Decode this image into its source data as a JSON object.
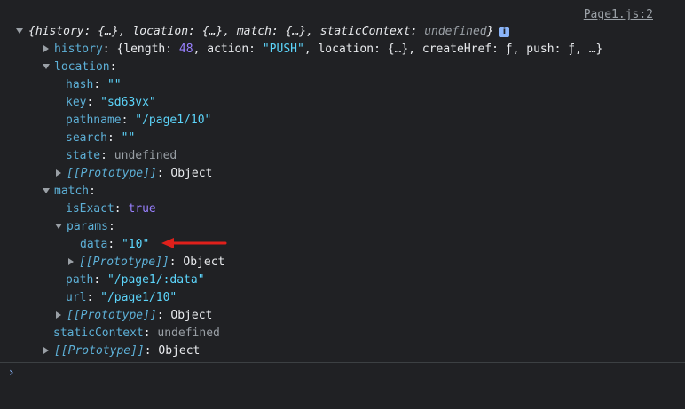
{
  "console": {
    "source_link": "Page1.js:2",
    "summary": {
      "open_brace": "{",
      "k1": "history",
      "v1": "{…}",
      "k2": "location",
      "v2": "{…}",
      "k3": "match",
      "v3": "{…}",
      "k4": "staticContext",
      "v4": "undefined",
      "close_brace": "}",
      "info": "i"
    },
    "history": {
      "key": "history",
      "preview_open": "{length: ",
      "length": "48",
      "sep1": ", action: ",
      "action": "\"PUSH\"",
      "rest": ", location: {…}, createHref: ƒ, push: ƒ, …}"
    },
    "location": {
      "key": "location",
      "hash_key": "hash",
      "hash": "\"\"",
      "key_key": "key",
      "key_val": "\"sd63vx\"",
      "pathname_key": "pathname",
      "pathname": "\"/page1/10\"",
      "search_key": "search",
      "search": "\"\"",
      "state_key": "state",
      "state": "undefined",
      "proto": "[[Prototype]]",
      "proto_val": "Object"
    },
    "match": {
      "key": "match",
      "isExact_key": "isExact",
      "isExact": "true",
      "params_key": "params",
      "data_key": "data",
      "data": "\"10\"",
      "params_proto": "[[Prototype]]",
      "params_proto_val": "Object",
      "path_key": "path",
      "path": "\"/page1/:data\"",
      "url_key": "url",
      "url": "\"/page1/10\"",
      "proto": "[[Prototype]]",
      "proto_val": "Object"
    },
    "staticContext": {
      "key": "staticContext",
      "value": "undefined"
    },
    "root_proto": {
      "key": "[[Prototype]]",
      "value": "Object"
    },
    "prompt": "›",
    "annotation_color": "#e0201b"
  }
}
